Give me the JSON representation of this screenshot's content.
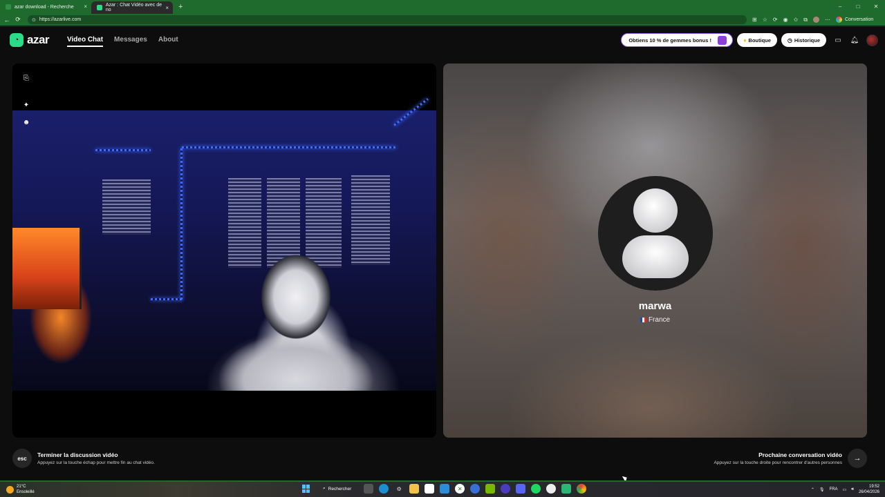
{
  "browser": {
    "tabs": [
      {
        "label": "azar download - Recherche",
        "close": "×"
      },
      {
        "label": "Azar : Chat Vidéo avec de no",
        "close": "×"
      }
    ],
    "new_tab": "+",
    "window_controls": {
      "minimize": "–",
      "maximize": "□",
      "close": "✕"
    },
    "nav": {
      "back": "←",
      "reload": "⟳"
    },
    "url": "https://azarlive.com",
    "conversation_label": "Conversation"
  },
  "app": {
    "logo_text": "azar",
    "nav": {
      "video_chat": "Video Chat",
      "messages": "Messages",
      "about": "About"
    },
    "gems_promo": "Obtiens 10 % de gemmes bonus !",
    "shop_label": "Boutique",
    "history_label": "Historique"
  },
  "peer": {
    "name": "marwa",
    "country": "France"
  },
  "bottom": {
    "esc_key": "esc",
    "end_title": "Terminer la discussion vidéo",
    "end_sub": "Appuyez sur la touche échap pour mettre fin au chat vidéo.",
    "next_title": "Prochaine conversation vidéo",
    "next_sub": "Appuyez sur la touche droite pour rencontrer d'autres personnes",
    "next_arrow": "→"
  },
  "taskbar": {
    "temp": "21°C",
    "weather": "Ensoleillé",
    "search": "Rechercher",
    "lang": "FRA",
    "time": "19:52",
    "date": "26/04/2026"
  },
  "colors": {
    "browser_green": "#1f6b2e",
    "brand_green": "#2bdc86",
    "gems_border": "#8a5cf6",
    "background": "#0d0d0d"
  }
}
